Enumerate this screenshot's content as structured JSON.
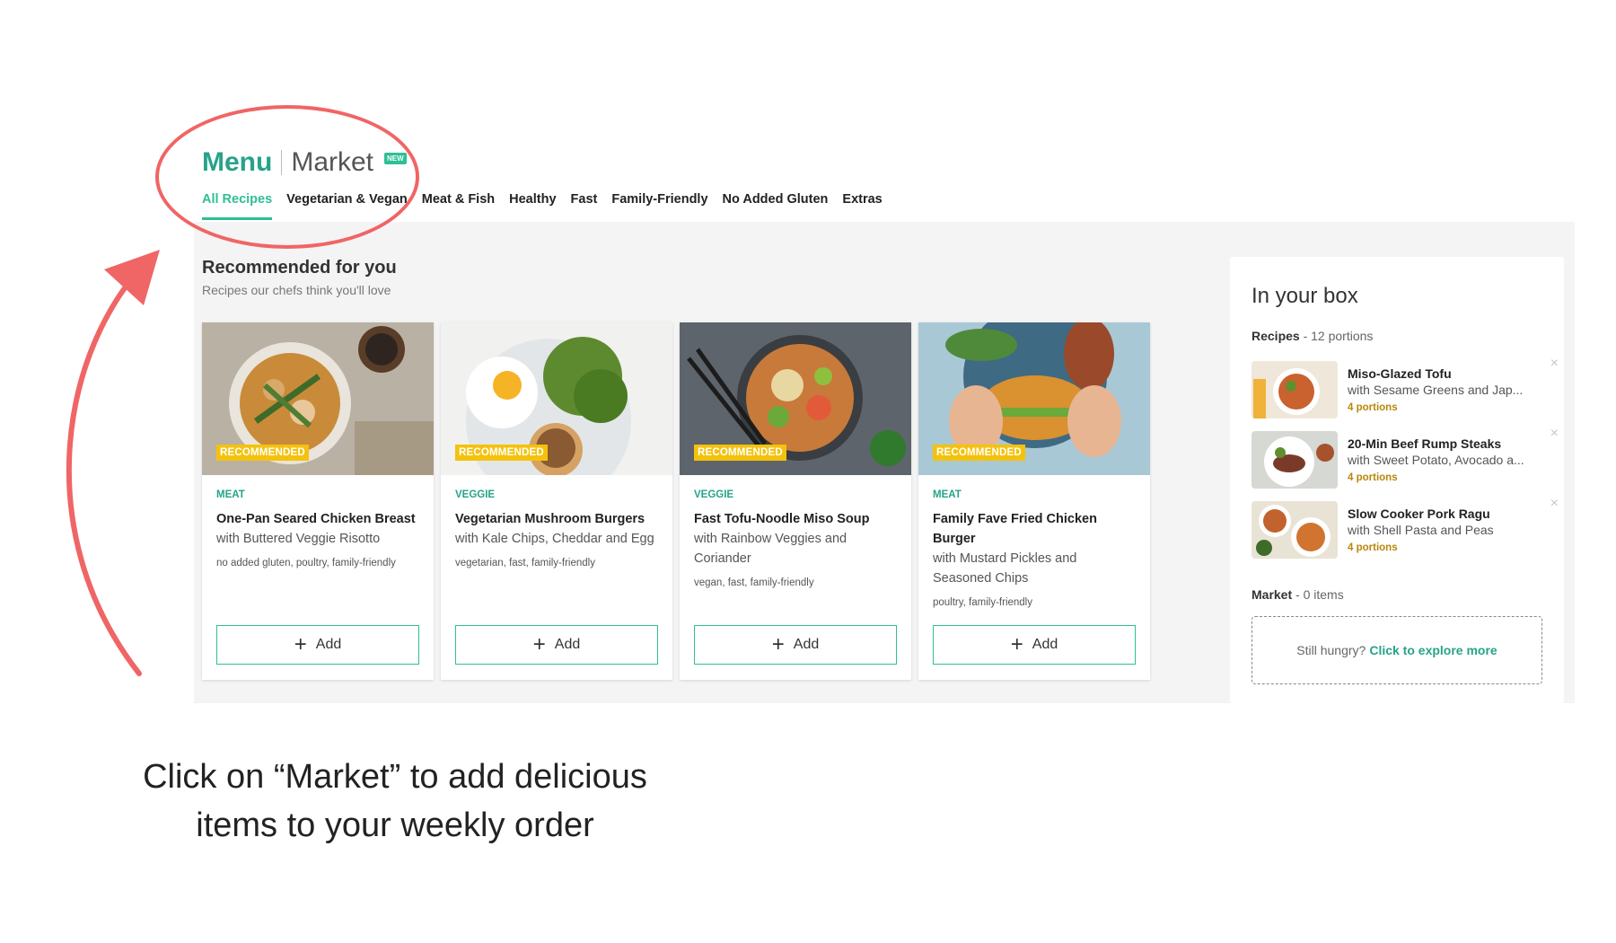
{
  "header": {
    "menu_label": "Menu",
    "market_label": "Market",
    "new_badge": "NEW"
  },
  "tabs": [
    {
      "label": "All Recipes",
      "active": true
    },
    {
      "label": "Vegetarian & Vegan"
    },
    {
      "label": "Meat & Fish"
    },
    {
      "label": "Healthy"
    },
    {
      "label": "Fast"
    },
    {
      "label": "Family-Friendly"
    },
    {
      "label": "No Added Gluten"
    },
    {
      "label": "Extras"
    }
  ],
  "recommended": {
    "title": "Recommended for you",
    "subtitle": "Recipes our chefs think you'll love",
    "badge": "RECOMMENDED",
    "add_label": "Add",
    "cards": [
      {
        "category": "MEAT",
        "title": "One-Pan Seared Chicken Breast",
        "description": "with Buttered Veggie Risotto",
        "tags": "no added gluten, poultry, family-friendly"
      },
      {
        "category": "VEGGIE",
        "title": "Vegetarian Mushroom Burgers",
        "description": "with Kale Chips, Cheddar and Egg",
        "tags": "vegetarian, fast, family-friendly"
      },
      {
        "category": "VEGGIE",
        "title": "Fast Tofu-Noodle Miso Soup",
        "description": "with Rainbow Veggies and Coriander",
        "tags": "vegan, fast, family-friendly"
      },
      {
        "category": "MEAT",
        "title": "Family Fave Fried Chicken Burger",
        "description": "with Mustard Pickles and Seasoned Chips",
        "tags": "poultry, family-friendly"
      }
    ]
  },
  "box": {
    "title": "In your box",
    "recipes_label": "Recipes",
    "recipes_count": " - 12 portions",
    "items": [
      {
        "title": "Miso-Glazed Tofu",
        "subtitle": "with Sesame Greens and Jap...",
        "portions": "4 portions"
      },
      {
        "title": "20-Min Beef Rump Steaks",
        "subtitle": "with Sweet Potato, Avocado a...",
        "portions": "4 portions"
      },
      {
        "title": "Slow Cooker Pork Ragu",
        "subtitle": "with Shell Pasta and Peas",
        "portions": "4 portions"
      }
    ],
    "market_label": "Market",
    "market_count": " - 0 items",
    "explore_prefix": "Still hungry?",
    "explore_link": "Click to explore more"
  },
  "annotation": {
    "line1": "Click on “Market” to add delicious",
    "line2": "items to your weekly order"
  },
  "colors": {
    "accent_green": "#2fbf95",
    "title_green": "#26a38a",
    "badge_yellow": "#f4c20d",
    "annotation_red": "#f06565",
    "panel_bg": "#f4f4f4"
  }
}
